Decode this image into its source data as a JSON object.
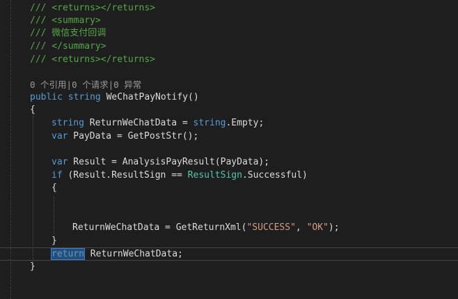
{
  "code": {
    "l1": "/// <returns></returns>",
    "l2": "/// <summary>",
    "l3": "/// 微信支付回调",
    "l4": "/// </summary>",
    "l5": "/// <returns></returns>",
    "codelens": "0 个引用|0 个请求|0 异常",
    "sig_public": "public",
    "sig_string": "string",
    "sig_name": " WeChatPayNotify()",
    "open_brace": "{",
    "s1_string": "string",
    "s1_mid": " ReturnWeChatData = ",
    "s1_string2": "string",
    "s1_end": ".Empty;",
    "s2_var": "var",
    "s2_rest": " PayData = GetPostStr();",
    "s3_var": "var",
    "s3_rest": " Result = AnalysisPayResult(PayData);",
    "s4_if": "if",
    "s4_mid": " (Result.ResultSign == ",
    "s4_type": "ResultSign",
    "s4_end": ".Successful)",
    "inner_open": "{",
    "s5_start": "ReturnWeChatData = GetReturnXml(",
    "s5_str1": "\"SUCCESS\"",
    "s5_comma": ", ",
    "s5_str2": "\"OK\"",
    "s5_end": ");",
    "inner_close": "}",
    "ret_kw": "return",
    "ret_rest": " ReturnWeChatData;",
    "close_brace": "}"
  }
}
